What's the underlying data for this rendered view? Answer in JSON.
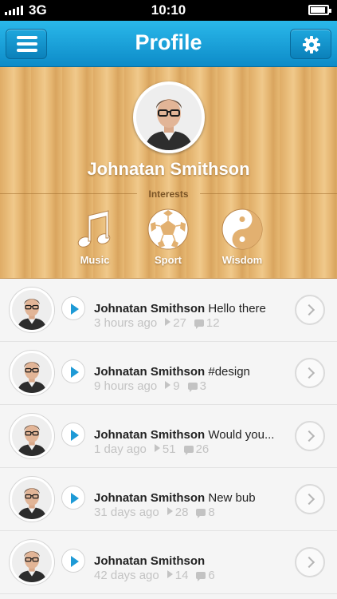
{
  "status_bar": {
    "carrier": "3G",
    "time": "10:10"
  },
  "navbar": {
    "title": "Profile"
  },
  "profile": {
    "name": "Johnatan Smithson",
    "interests_label": "Interests",
    "interests": [
      {
        "label": "Music",
        "icon": "music-note-icon"
      },
      {
        "label": "Sport",
        "icon": "soccer-ball-icon"
      },
      {
        "label": "Wisdom",
        "icon": "yin-yang-icon"
      }
    ]
  },
  "feed": [
    {
      "author": "Johnatan Smithson",
      "text": "Hello there",
      "time": "3 hours ago",
      "plays": "27",
      "comments": "12"
    },
    {
      "author": "Johnatan Smithson",
      "text": "#design",
      "time": "9 hours ago",
      "plays": "9",
      "comments": "3"
    },
    {
      "author": "Johnatan Smithson",
      "text": "Would you...",
      "time": "1 day ago",
      "plays": "51",
      "comments": "26"
    },
    {
      "author": "Johnatan Smithson",
      "text": "New bub",
      "time": "31 days ago",
      "plays": "28",
      "comments": "8"
    },
    {
      "author": "Johnatan Smithson",
      "text": "",
      "time": "42 days ago",
      "plays": "14",
      "comments": "6"
    }
  ],
  "colors": {
    "nav_blue": "#1a9fd8",
    "accent_play": "#1e9ad6",
    "wood": "#e6b873"
  }
}
